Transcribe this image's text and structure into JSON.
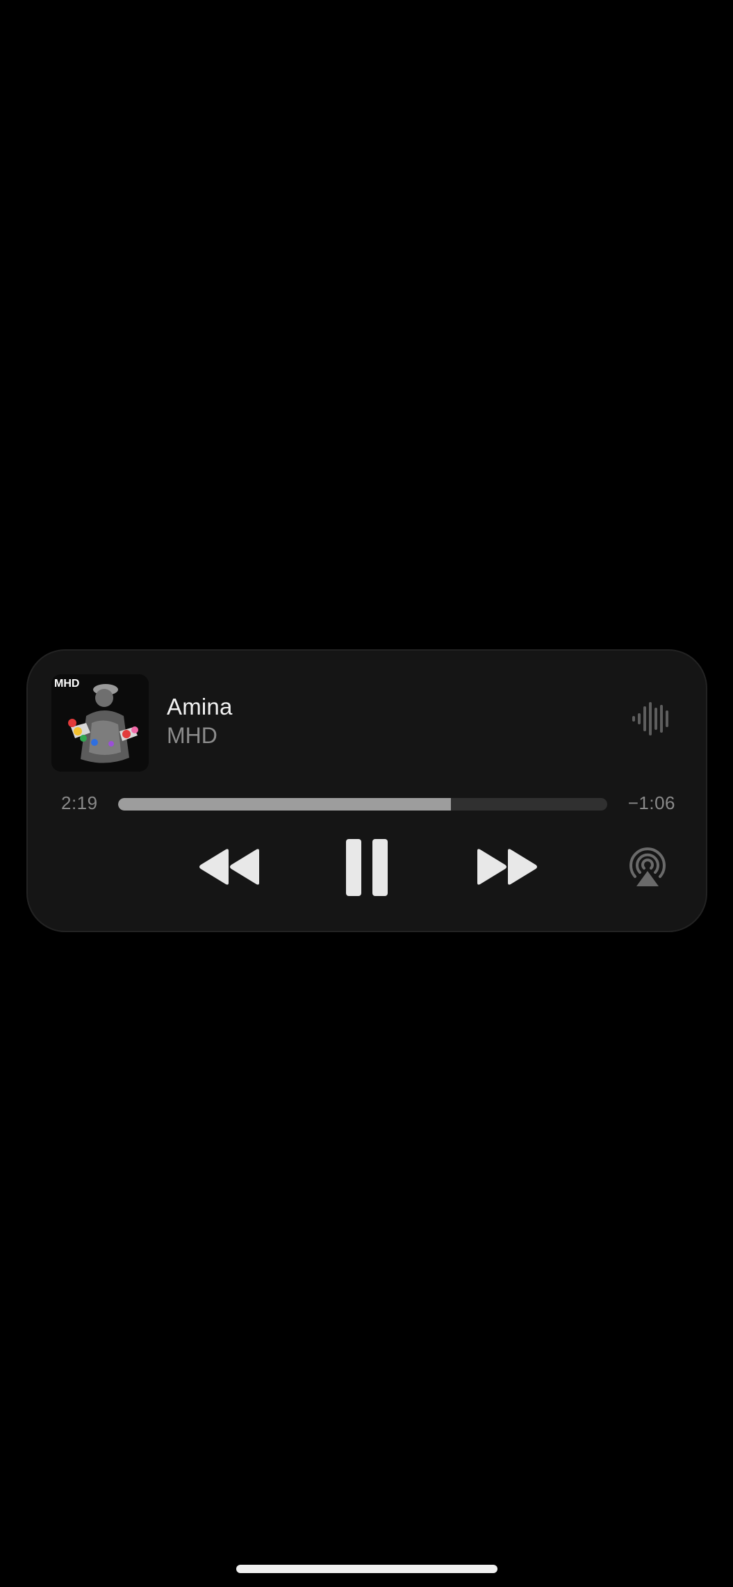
{
  "now_playing": {
    "title": "Amina",
    "artist": "MHD",
    "artwork_label": "MHD",
    "elapsed": "2:19",
    "remaining": "−1:06",
    "progress": 0.68
  },
  "controls": {
    "rewind_icon": "rewind-icon",
    "pause_icon": "pause-icon",
    "forward_icon": "fast-forward-icon",
    "airplay_icon": "airplay-icon",
    "waveform_icon": "audio-waveform-icon"
  },
  "colors": {
    "background": "#000000",
    "card": "#151515",
    "progress_fill": "#9d9d9d",
    "progress_track": "#303030"
  }
}
